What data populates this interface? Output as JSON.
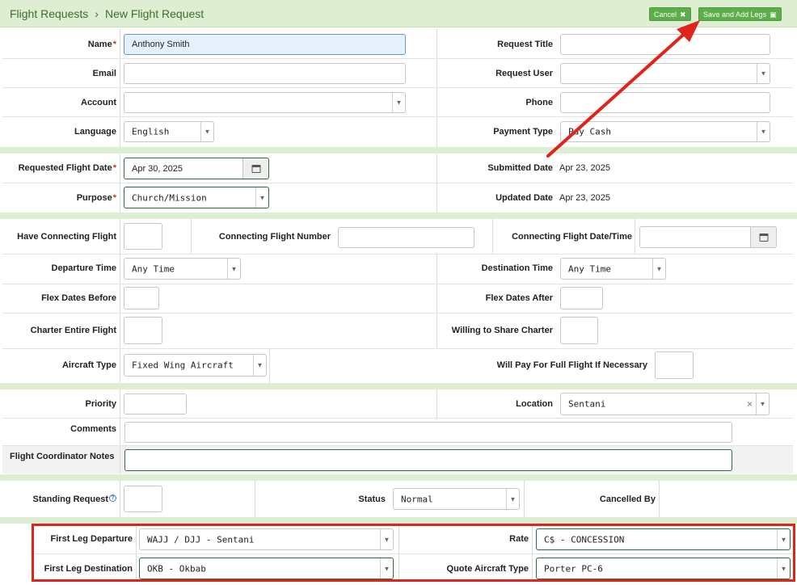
{
  "breadcrumb": {
    "parent": "Flight Requests",
    "current": "New Flight Request"
  },
  "toolbar": {
    "cancel_label": "Cancel",
    "save_label": "Save and Add Legs"
  },
  "section1": {
    "name_label": "Name",
    "name_value": "Anthony Smith",
    "request_title_label": "Request Title",
    "email_label": "Email",
    "request_user_label": "Request User",
    "account_label": "Account",
    "phone_label": "Phone",
    "language_label": "Language",
    "language_value": "English",
    "payment_type_label": "Payment Type",
    "payment_type_value": "Pay Cash"
  },
  "section2": {
    "requested_date_label": "Requested Flight Date",
    "requested_date_value": "Apr 30, 2025",
    "submitted_date_label": "Submitted Date",
    "submitted_date_value": "Apr 23, 2025",
    "purpose_label": "Purpose",
    "purpose_value": "Church/Mission",
    "updated_date_label": "Updated Date",
    "updated_date_value": "Apr 23, 2025"
  },
  "section3": {
    "have_connecting_label": "Have Connecting Flight",
    "connecting_number_label": "Connecting Flight Number",
    "connecting_datetime_label": "Connecting Flight Date/Time",
    "departure_time_label": "Departure Time",
    "departure_time_value": "Any Time",
    "destination_time_label": "Destination Time",
    "destination_time_value": "Any Time",
    "flex_before_label": "Flex Dates Before",
    "flex_after_label": "Flex Dates After",
    "charter_entire_label": "Charter Entire Flight",
    "willing_share_label": "Willing to Share Charter",
    "aircraft_type_label": "Aircraft Type",
    "aircraft_type_value": "Fixed Wing Aircraft",
    "will_pay_label": "Will Pay For Full Flight If Necessary"
  },
  "section4": {
    "priority_label": "Priority",
    "location_label": "Location",
    "location_value": "Sentani",
    "comments_label": "Comments",
    "coordinator_notes_label": "Flight Coordinator Notes"
  },
  "section5": {
    "standing_request_label": "Standing Request",
    "status_label": "Status",
    "status_value": "Normal",
    "cancelled_by_label": "Cancelled By"
  },
  "section6": {
    "first_leg_departure_label": "First Leg Departure",
    "first_leg_departure_value": "WAJJ / DJJ - Sentani",
    "rate_label": "Rate",
    "rate_value": "C$ - CONCESSION",
    "first_leg_destination_label": "First Leg Destination",
    "first_leg_destination_value": "OKB - Okbab",
    "quote_aircraft_label": "Quote Aircraft Type",
    "quote_aircraft_value": "Porter PC-6"
  },
  "colors": {
    "accent_green": "#5cae48",
    "header_bg": "#deeed2",
    "annotation_red": "#e0231b"
  }
}
